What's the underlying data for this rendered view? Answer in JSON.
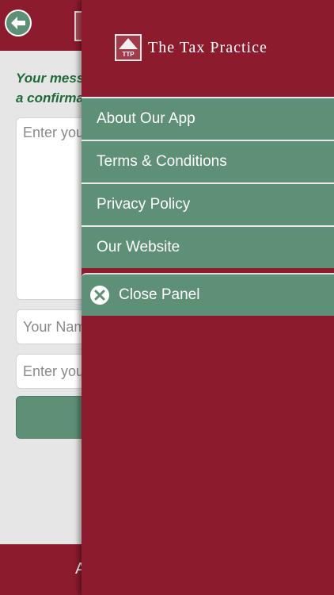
{
  "background": {
    "message_text_line1": "Your mess",
    "message_text_line2": "a confirma",
    "message_placeholder": "Enter you",
    "name_placeholder": "Your Nam",
    "email_placeholder": "Enter you",
    "bottom_text": "A"
  },
  "panel": {
    "logo_initials": "TTP",
    "logo_text": "The Tax Practice",
    "menu_items": [
      {
        "label": "About Our App"
      },
      {
        "label": "Terms & Conditions"
      },
      {
        "label": "Privacy Policy"
      },
      {
        "label": "Our Website"
      }
    ],
    "close_label": "Close Panel"
  },
  "colors": {
    "brand": "#8c1b2e",
    "accent": "#5e8f77",
    "message_text": "#1f6a3a"
  }
}
